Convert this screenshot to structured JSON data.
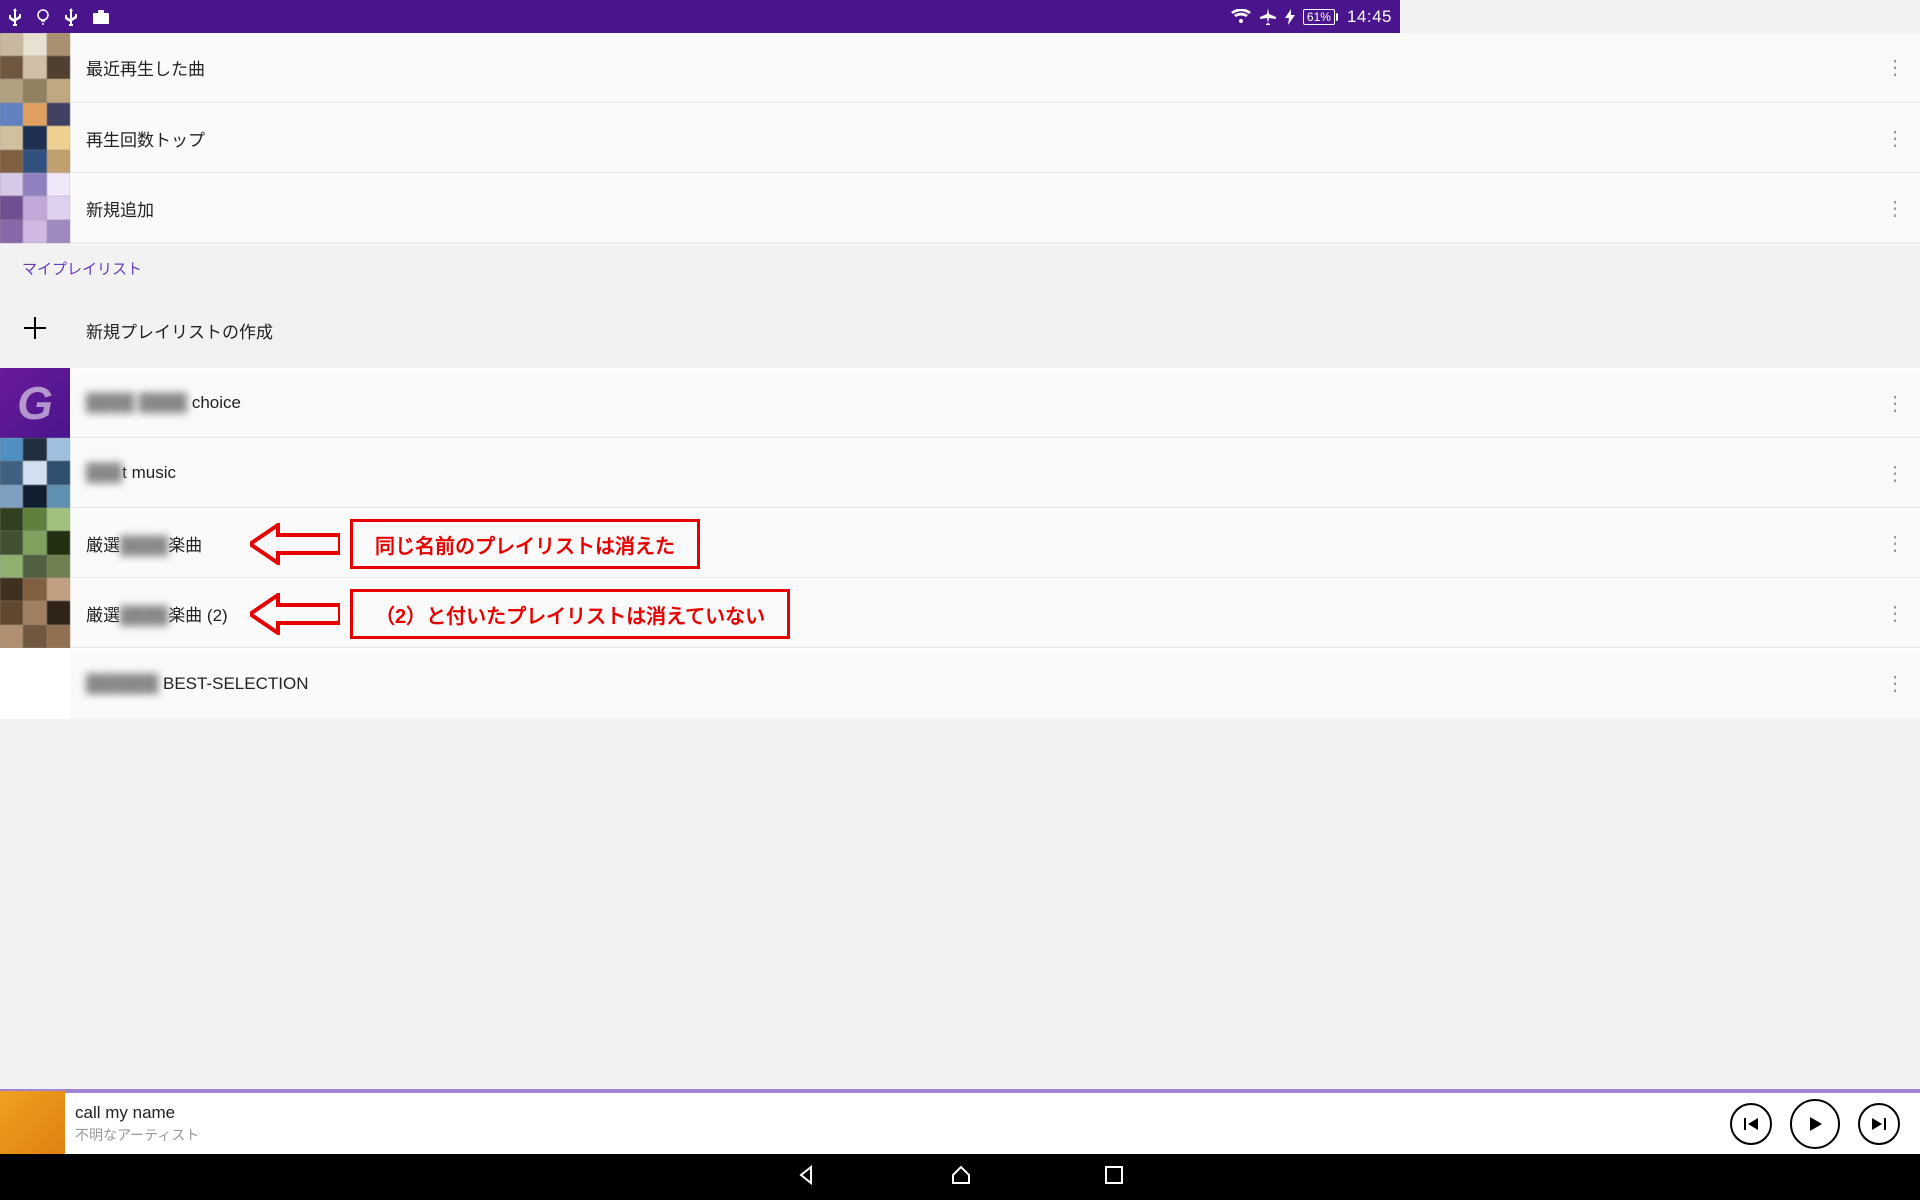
{
  "status": {
    "battery_text": "61%",
    "clock": "14:45"
  },
  "smart_lists": [
    {
      "label": "最近再生した曲"
    },
    {
      "label": "再生回数トップ"
    },
    {
      "label": "新規追加"
    }
  ],
  "section_header": "マイプレイリスト",
  "new_playlist_label": "新規プレイリストの作成",
  "playlists": [
    {
      "label_obscured": "████ ████",
      "label_suffix": " choice"
    },
    {
      "label_obscured": "███",
      "label_suffix": "t music"
    },
    {
      "label_prefix": "厳選",
      "label_obscured": "████",
      "label_suffix": "楽曲"
    },
    {
      "label_prefix": "厳選",
      "label_obscured": "████",
      "label_suffix": "楽曲 (2)"
    },
    {
      "label_obscured": "██████",
      "label_suffix": " BEST-SELECTION"
    }
  ],
  "annotations": [
    {
      "text": "同じ名前のプレイリストは消えた"
    },
    {
      "text": "（2）と付いたプレイリストは消えていない"
    }
  ],
  "now_playing": {
    "title": "call my name",
    "artist": "不明なアーティスト"
  }
}
